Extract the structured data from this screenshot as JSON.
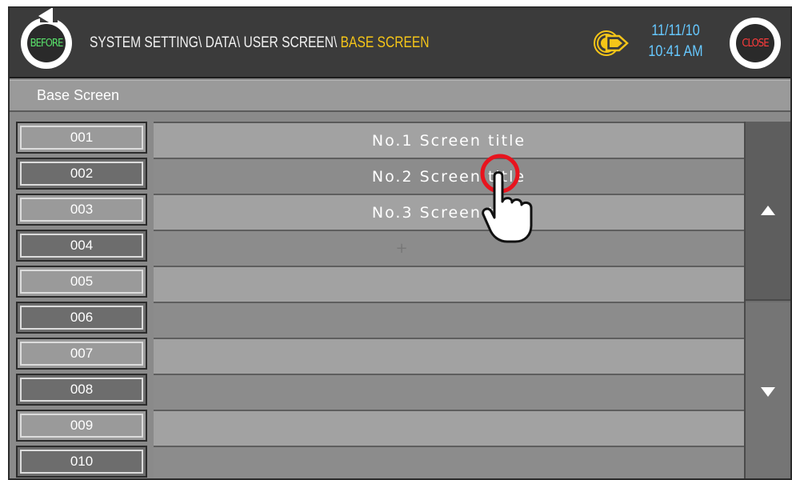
{
  "header": {
    "before_label": "BEFORE",
    "close_label": "CLOSE",
    "breadcrumb": "SYSTEM SETTING\\ DATA\\ USER SCREEN\\ ",
    "breadcrumb_current": "BASE SCREEN",
    "date": "11/11/10",
    "time": "10:41 AM",
    "bell_icon": "speaker-bell-icon"
  },
  "page": {
    "title": "Base Screen"
  },
  "numbers": [
    "001",
    "002",
    "003",
    "004",
    "005",
    "006",
    "007",
    "008",
    "009",
    "010"
  ],
  "screens": [
    "No.1 Screen title",
    "No.2 Screen title",
    "No.3 Screen title",
    "",
    "",
    "",
    "",
    "",
    "",
    ""
  ],
  "colors": {
    "header_bg": "#3b3b3b",
    "accent_path": "#f5c518",
    "datetime": "#66c8ff",
    "before_text": "#59e06a",
    "close_text": "#ff3b3b",
    "click_ring": "#e8141e"
  }
}
